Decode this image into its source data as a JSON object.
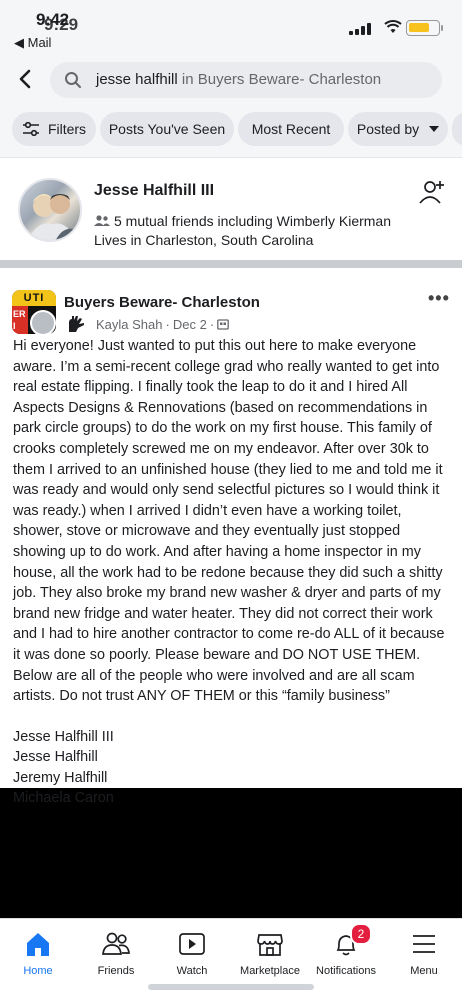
{
  "status_bar": {
    "time": "9:42",
    "time_ghost": "9:29",
    "back_app": "◀ Mail",
    "battery_level": 0.7
  },
  "search": {
    "query": "jesse halfhill",
    "scope": "in Buyers Beware- Charleston"
  },
  "filters": [
    {
      "label": "Filters",
      "icon": "sliders-icon"
    },
    {
      "label": "Posts You've Seen"
    },
    {
      "label": "Most Recent"
    },
    {
      "label": "Posted by",
      "icon": "caret-down-icon"
    }
  ],
  "person_result": {
    "name": "Jesse Halfhill III",
    "mutual_friends": "5 mutual friends including Wimberly Kierman",
    "lives_in": "Lives in Charleston, South Carolina",
    "action_icon": "add-friend-icon"
  },
  "post": {
    "group_name": "Buyers Beware- Charleston",
    "group_avatar_text_top": "UTI",
    "group_avatar_text_side": "ER I",
    "author": "Kayla Shah",
    "date": "Dec 2",
    "privacy_icon": "members-only-icon",
    "more_icon": "more-dots-icon",
    "body": "Hi everyone! Just wanted to put this out here to make everyone aware. I’m a semi-recent college grad who really wanted to get into real estate flipping. I finally took the leap to do it and I hired All Aspects Designs & Rennovations (based on recommendations in park circle groups) to do the work on my first house. This family of crooks completely screwed me on my endeavor. After over 30k to them I arrived to an unfinished house (they lied to me and told me it was ready and would only send selectful pictures so I would think it was ready.) when I arrived I didn’t even have a working toilet, shower, stove or microwave and they eventually just stopped showing up to do work. And after having a home inspector in my house, all the work had to be redone because they did such a shitty job. They also broke my brand new washer & dryer and parts of my brand new fridge and water heater. They did not correct their work and I had to hire another contractor to come re-do ALL of it because it was done so poorly. Please beware and DO NOT USE THEM. Below are all of the people who were involved and are all scam artists. Do not trust ANY OF THEM or this “family business”",
    "names": [
      "Jesse Halfhill III",
      "Jesse Halfhill",
      "Jeremy Halfhill",
      "Michaela Caron"
    ]
  },
  "tabbar": [
    {
      "label": "Home",
      "icon": "home-icon",
      "active": true
    },
    {
      "label": "Friends",
      "icon": "friends-icon"
    },
    {
      "label": "Watch",
      "icon": "watch-icon"
    },
    {
      "label": "Marketplace",
      "icon": "marketplace-icon"
    },
    {
      "label": "Notifications",
      "icon": "bell-icon",
      "badge": "2"
    },
    {
      "label": "Menu",
      "icon": "menu-icon"
    }
  ],
  "colors": {
    "accent": "#1877f2",
    "badge": "#e41e3f",
    "battery": "#f7c11e"
  }
}
